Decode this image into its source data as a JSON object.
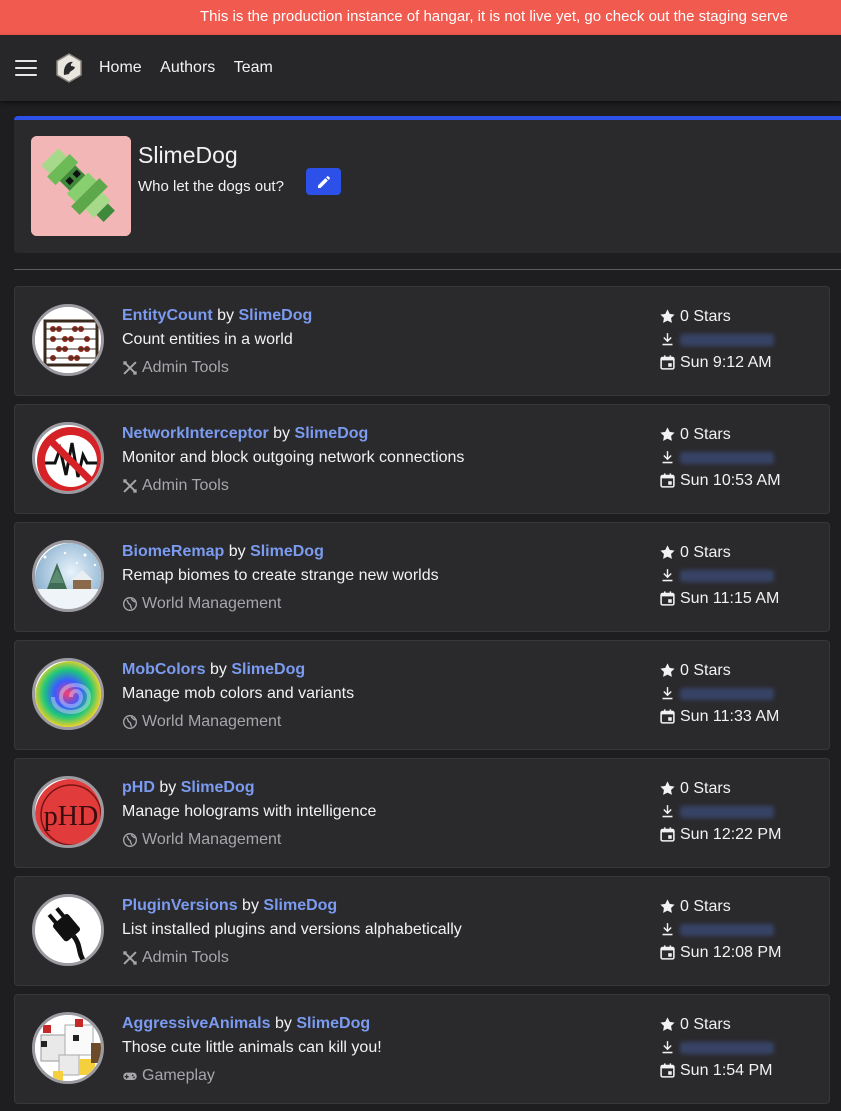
{
  "banner": {
    "text": "This is the production instance of hangar, it is not live yet, go check out the staging serve"
  },
  "nav": {
    "home": "Home",
    "authors": "Authors",
    "team": "Team"
  },
  "profile": {
    "name": "SlimeDog",
    "tagline": "Who let the dogs out?"
  },
  "by_label": "by",
  "projects": [
    {
      "name": "EntityCount",
      "author": "SlimeDog",
      "description": "Count entities in a world",
      "category": "Admin Tools",
      "category_icon": "tools-icon",
      "stars": "0 Stars",
      "date": "Sun 9:12 AM",
      "icon": "abacus-icon"
    },
    {
      "name": "NetworkInterceptor",
      "author": "SlimeDog",
      "description": "Monitor and block outgoing network connections",
      "category": "Admin Tools",
      "category_icon": "tools-icon",
      "stars": "0 Stars",
      "date": "Sun 10:53 AM",
      "icon": "no-signal-icon"
    },
    {
      "name": "BiomeRemap",
      "author": "SlimeDog",
      "description": "Remap biomes to create strange new worlds",
      "category": "World Management",
      "category_icon": "globe-icon",
      "stars": "0 Stars",
      "date": "Sun 11:15 AM",
      "icon": "snow-globe-icon"
    },
    {
      "name": "MobColors",
      "author": "SlimeDog",
      "description": "Manage mob colors and variants",
      "category": "World Management",
      "category_icon": "globe-icon",
      "stars": "0 Stars",
      "date": "Sun 11:33 AM",
      "icon": "color-swirl-icon"
    },
    {
      "name": "pHD",
      "author": "SlimeDog",
      "description": "Manage holograms with intelligence",
      "category": "World Management",
      "category_icon": "globe-icon",
      "stars": "0 Stars",
      "date": "Sun 12:22 PM",
      "icon": "phd-logo-icon",
      "icon_text": "pHD"
    },
    {
      "name": "PluginVersions",
      "author": "SlimeDog",
      "description": "List installed plugins and versions alphabetically",
      "category": "Admin Tools",
      "category_icon": "tools-icon",
      "stars": "0 Stars",
      "date": "Sun 12:08 PM",
      "icon": "plug-icon"
    },
    {
      "name": "AggressiveAnimals",
      "author": "SlimeDog",
      "description": "Those cute little animals can kill you!",
      "category": "Gameplay",
      "category_icon": "gamepad-icon",
      "stars": "0 Stars",
      "date": "Sun 1:54 PM",
      "icon": "chicken-icon"
    }
  ],
  "colors": {
    "accent": "#2c50e8",
    "link": "#7b9bf0",
    "banner": "#f15a4f"
  }
}
